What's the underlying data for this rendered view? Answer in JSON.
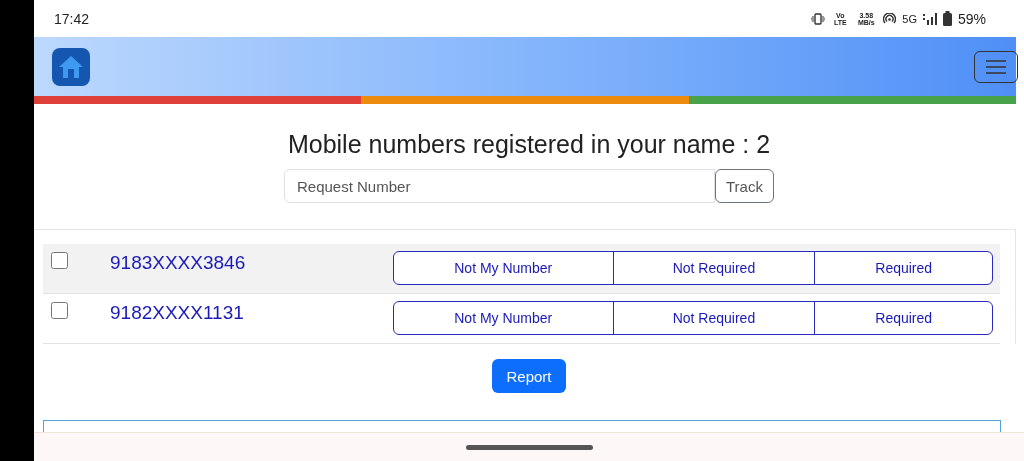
{
  "status_bar": {
    "time": "17:42",
    "network_label": "Vo LTE",
    "speed": "3.58 MB/s",
    "network_type": "5G",
    "battery": "59%"
  },
  "heading": "Mobile numbers registered in your name : 2",
  "search": {
    "placeholder": "Request Number",
    "button": "Track"
  },
  "numbers": [
    {
      "number": "9183XXXX3846",
      "checked": false,
      "highlighted": true,
      "actions": [
        "Not My Number",
        "Not Required",
        "Required"
      ]
    },
    {
      "number": "9182XXXX1131",
      "checked": false,
      "highlighted": false,
      "actions": [
        "Not My Number",
        "Not Required",
        "Required"
      ]
    }
  ],
  "report_button": "Report"
}
